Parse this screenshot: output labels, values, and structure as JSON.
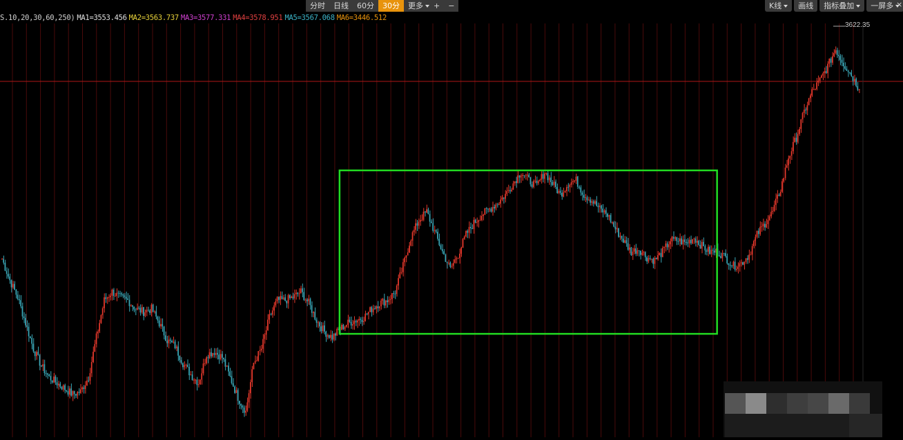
{
  "toolbar": {
    "group1": [
      {
        "label": "分时",
        "active": false
      },
      {
        "label": "日线",
        "active": false
      },
      {
        "label": "60分",
        "active": false
      },
      {
        "label": "30分",
        "active": true
      },
      {
        "label": "更多",
        "active": false,
        "dropdown": true
      }
    ],
    "zoom_in": "+",
    "zoom_out": "−",
    "right": [
      {
        "label": "K线",
        "dropdown": true
      },
      {
        "label": "画线",
        "dropdown": false
      },
      {
        "label": "指标叠加",
        "dropdown": true
      },
      {
        "label": "一屏多",
        "dropdown": true
      }
    ],
    "close": "×"
  },
  "ma_legend": [
    {
      "text": "S.10,20,30,60,250)",
      "color": "#d0d0d0"
    },
    {
      "text": "MA1=3553.456",
      "color": "#e0e0e0"
    },
    {
      "text": "MA2=3563.737",
      "color": "#e8d23a"
    },
    {
      "text": "MA3=3577.331",
      "color": "#d040d0"
    },
    {
      "text": "MA4=3578.951",
      "color": "#e04040"
    },
    {
      "text": "MA5=3567.068",
      "color": "#3cb4c8"
    },
    {
      "text": "MA6=3446.512",
      "color": "#e8930c"
    }
  ],
  "chart_data": {
    "type": "candlestick",
    "max_label": "3622.35",
    "ylim": [
      3350,
      3640
    ],
    "colors": {
      "up": "#e8392c",
      "down": "#3aa8b8",
      "grid": "#4a0a0a",
      "highlight": "#22dd22",
      "hline": "#b01818"
    },
    "series_close_path": [
      3475,
      3460,
      3448,
      3430,
      3412,
      3400,
      3392,
      3388,
      3384,
      3380,
      3382,
      3392,
      3420,
      3446,
      3452,
      3448,
      3446,
      3440,
      3438,
      3440,
      3430,
      3418,
      3414,
      3402,
      3394,
      3388,
      3408,
      3410,
      3406,
      3392,
      3378,
      3368,
      3402,
      3412,
      3434,
      3446,
      3446,
      3448,
      3452,
      3444,
      3432,
      3424,
      3420,
      3426,
      3430,
      3432,
      3434,
      3440,
      3444,
      3446,
      3452,
      3470,
      3490,
      3502,
      3508,
      3494,
      3480,
      3468,
      3478,
      3492,
      3500,
      3506,
      3510,
      3514,
      3520,
      3528,
      3536,
      3530,
      3526,
      3536,
      3528,
      3520,
      3528,
      3530,
      3520,
      3516,
      3510,
      3506,
      3496,
      3488,
      3480,
      3482,
      3476,
      3474,
      3480,
      3488,
      3488,
      3486,
      3490,
      3484,
      3480,
      3480,
      3476,
      3470,
      3472,
      3478,
      3492,
      3500,
      3508,
      3524,
      3546,
      3560,
      3578,
      3592,
      3600,
      3610,
      3622,
      3612,
      3604,
      3594
    ],
    "highlight_range": {
      "from_index": 43,
      "to_index": 91
    }
  },
  "watermark": {
    "visible": true
  }
}
